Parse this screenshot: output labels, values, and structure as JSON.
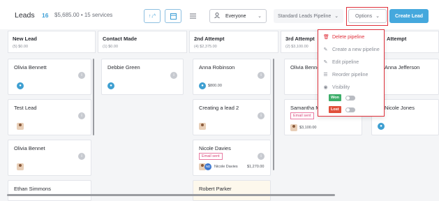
{
  "header": {
    "title": "Leads",
    "count": "16",
    "summary": "$5,685.00 • 15 services",
    "owner_filter": "Everyone",
    "pipeline_select": "Standard Leads Pipeline",
    "options_label": "Options",
    "create_label": "Create Lead"
  },
  "columns": [
    {
      "name": "New Lead",
      "sub": "(5) $0.00"
    },
    {
      "name": "Contact Made",
      "sub": "(1) $0.00"
    },
    {
      "name": "2nd Attempt",
      "sub": "(4) $2,375.00"
    },
    {
      "name": "3rd Attempt",
      "sub": "(2) $3,100.00"
    },
    {
      "name": "Attempt",
      "sub": ""
    }
  ],
  "cards": {
    "c1": {
      "name": "Olivia Bennett"
    },
    "c2": {
      "name": "Test Lead"
    },
    "c3": {
      "name": "Olivia Bennet"
    },
    "c4": {
      "name": "Ethan Simmons"
    },
    "c5": {
      "name": "Debbie Green"
    },
    "c6": {
      "name": "Anna Robinson",
      "amount": "$800.00"
    },
    "c7": {
      "name": "Creating a lead 2"
    },
    "c8": {
      "name": "Nicole Davies",
      "tag": "Email sent",
      "owner": "Nicole Davies",
      "amount": "$1,270.00",
      "initials": "ND"
    },
    "c9": {
      "name": "Robert Parker"
    },
    "c10": {
      "name": "Olivia Bennett"
    },
    "c11": {
      "name": "Samantha Mi",
      "tag": "Email sent",
      "amount": "$3,100.00"
    },
    "c12": {
      "name": "Anna Jefferson"
    },
    "c13": {
      "name": "Nicole Jones"
    }
  },
  "dropdown": {
    "delete": "Delete pipeline",
    "create": "Create a new pipeline",
    "edit": "Edit pipeline",
    "reorder": "Reorder pipeline",
    "visibility": "Visibility",
    "won": "Won",
    "lost": "Lost"
  },
  "colors": {
    "accent": "#45a8dd",
    "danger": "#e0303b",
    "won": "#3dae6a",
    "lost": "#e0503b"
  }
}
